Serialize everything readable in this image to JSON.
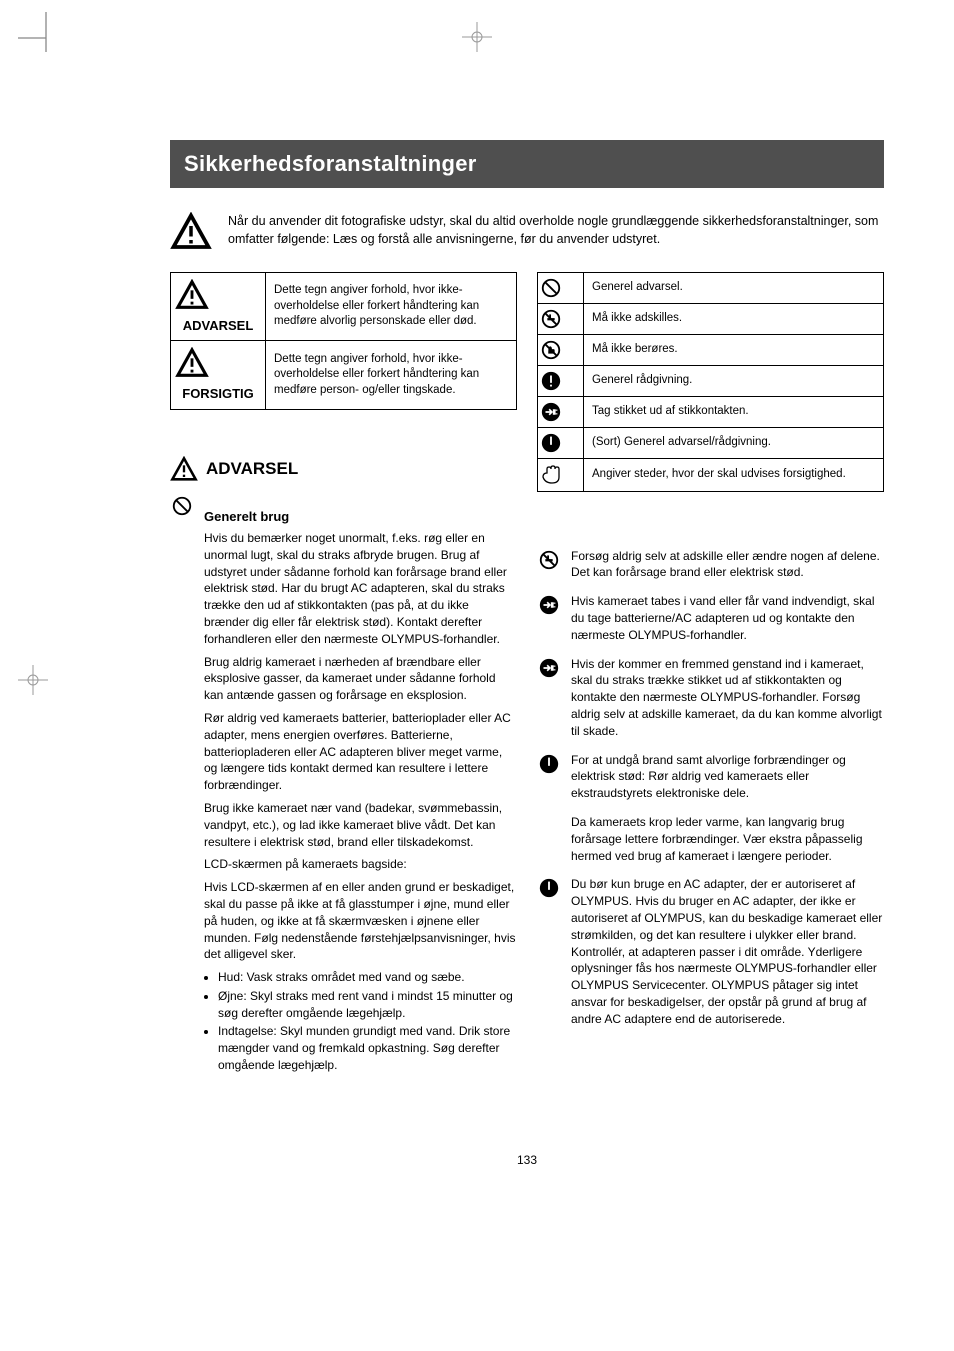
{
  "title": "Sikkerhedsforanstaltninger",
  "intro": "Når du anvender dit fotografiske udstyr, skal du altid overholde nogle grundlæggende sikkerhedsforanstaltninger, som omfatter følgende:\nLæs og forstå alle anvisningerne, før du anvender udstyret.",
  "left_table": {
    "cell1_label": "ADVARSEL",
    "cell1_text": "Dette tegn angiver forhold, hvor ikke-overholdelse eller forkert håndtering kan medføre alvorlig personskade eller død.",
    "cell2_label": "FORSIGTIG",
    "cell2_text": "Dette tegn angiver forhold, hvor ikke-overholdelse eller forkert håndtering kan medføre person- og/eller tingskade."
  },
  "right_table": {
    "r1": "Generel advarsel.",
    "r2": "Må ikke adskilles.",
    "r3": "Må ikke berøres.",
    "r4": "Generel rådgivning.",
    "r5": "Tag stikket ud af stikkontakten.",
    "r6": "(Sort) Generel advarsel/rådgivning.",
    "r7": "Angiver steder, hvor der skal udvises forsigtighed."
  },
  "warning_heading": "ADVARSEL",
  "section_a": {
    "sub": "Generelt brug",
    "p1": "Hvis du bemærker noget unormalt, f.eks. røg eller en unormal lugt, skal du straks afbryde brugen. Brug af udstyret under sådanne forhold kan forårsage brand eller elektrisk stød. Har du brugt AC adapteren, skal du straks trække den ud af stikkontakten (pas på, at du ikke brænder dig eller får elektrisk stød). Kontakt derefter forhandleren eller den nærmeste OLYMPUS-forhandler.",
    "p2": "Brug aldrig kameraet i nærheden af brændbare eller eksplosive gasser, da kameraet under sådanne forhold kan antænde gassen og forårsage en eksplosion.",
    "p3": "Rør aldrig ved kameraets batterier, batterioplader eller AC adapter, mens energien overføres. Batterierne, batteriopladeren eller AC adapteren bliver meget varme, og længere tids kontakt dermed kan resultere i lettere forbrændinger.",
    "p4": "Brug ikke kameraet nær vand (badekar, svømmebassin, vandpyt, etc.), og lad ikke kameraet blive vådt. Det kan resultere i elektrisk stød, brand eller tilskadekomst.",
    "p5_lines": [
      "LCD-skærmen på kameraets bagside:",
      "Hvis LCD-skærmen af en eller anden grund er beskadiget, skal du passe på ikke at få glasstumper i øjne, mund eller på huden, og ikke at få skærmvæsken i øjnene eller munden. Følg nedenstående førstehjælpsanvisninger, hvis det alligevel sker."
    ],
    "bullets": [
      "Hud: Vask straks området med vand og sæbe.",
      "Øjne: Skyl straks med rent vand i mindst 15 minutter og søg derefter omgående lægehjælp.",
      "Indtagelse: Skyl munden grundigt med vand. Drik store mængder vand og fremkald opkastning. Søg derefter omgående lægehjælp."
    ]
  },
  "section_b": {
    "items": [
      "Forsøg aldrig selv at adskille eller ændre nogen af delene. Det kan forårsage brand eller elektrisk stød.",
      "Hvis kameraet tabes i vand eller får vand indvendigt, skal du tage batterierne/AC adapteren ud og kontakte den nærmeste OLYMPUS-forhandler.",
      "Hvis der kommer en fremmed genstand ind i kameraet, skal du straks trække stikket ud af stikkontakten og kontakte den nærmeste OLYMPUS-forhandler. Forsøg aldrig selv at adskille kameraet, da du kan komme alvorligt til skade.",
      "For at undgå brand samt alvorlige forbrændinger og elektrisk stød: Rør aldrig ved kameraets eller ekstraudstyrets elektroniske dele.",
      "Da kameraets krop leder varme, kan langvarig brug forårsage lettere forbrændinger. Vær ekstra påpasselig hermed ved brug af kameraet i længere perioder.",
      "Du bør kun bruge en AC adapter, der er autoriseret af OLYMPUS. Hvis du bruger en AC adapter, der ikke er autoriseret af OLYMPUS, kan du beskadige kameraet eller strømkilden, og det kan resultere i ulykker eller brand. Kontrollér, at adapteren passer i dit område. Yderligere oplysninger fås hos nærmeste OLYMPUS-forhandler eller OLYMPUS Servicecenter. OLYMPUS påtager sig intet ansvar for beskadigelser, der opstår på grund af brug af andre AC adaptere end de autoriserede."
    ]
  },
  "page_number": "133",
  "icons": {
    "tri": "warning-triangle-icon",
    "prohibit": "prohibit-icon",
    "disassemble": "no-disassemble-icon",
    "notouch": "no-touch-icon",
    "mandatory": "mandatory-icon",
    "unplug": "unplug-icon",
    "blackwarn": "black-circle-icon",
    "hand": "caution-hand-icon"
  }
}
